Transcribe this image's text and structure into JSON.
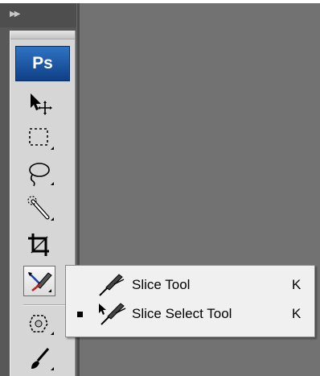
{
  "app": {
    "logo_text": "Ps"
  },
  "toolbar": {
    "tools": [
      {
        "icon": "move-tool-icon"
      },
      {
        "icon": "rectangular-marquee-icon"
      },
      {
        "icon": "lasso-icon"
      },
      {
        "icon": "quick-selection-icon"
      },
      {
        "icon": "crop-icon"
      },
      {
        "icon": "slice-tool-icon",
        "active": true
      },
      {
        "icon": "spot-healing-brush-icon"
      },
      {
        "icon": "brush-icon"
      }
    ]
  },
  "flyout": {
    "items": [
      {
        "label": "Slice Tool",
        "shortcut": "K",
        "selected": false,
        "icon": "slice-tool-icon"
      },
      {
        "label": "Slice Select Tool",
        "shortcut": "K",
        "selected": true,
        "icon": "slice-select-icon"
      }
    ]
  },
  "colors": {
    "workspace": "#727272",
    "logo": "#1a56a8",
    "panel": "#d6d6d6",
    "flyout": "#f0f0f0"
  }
}
